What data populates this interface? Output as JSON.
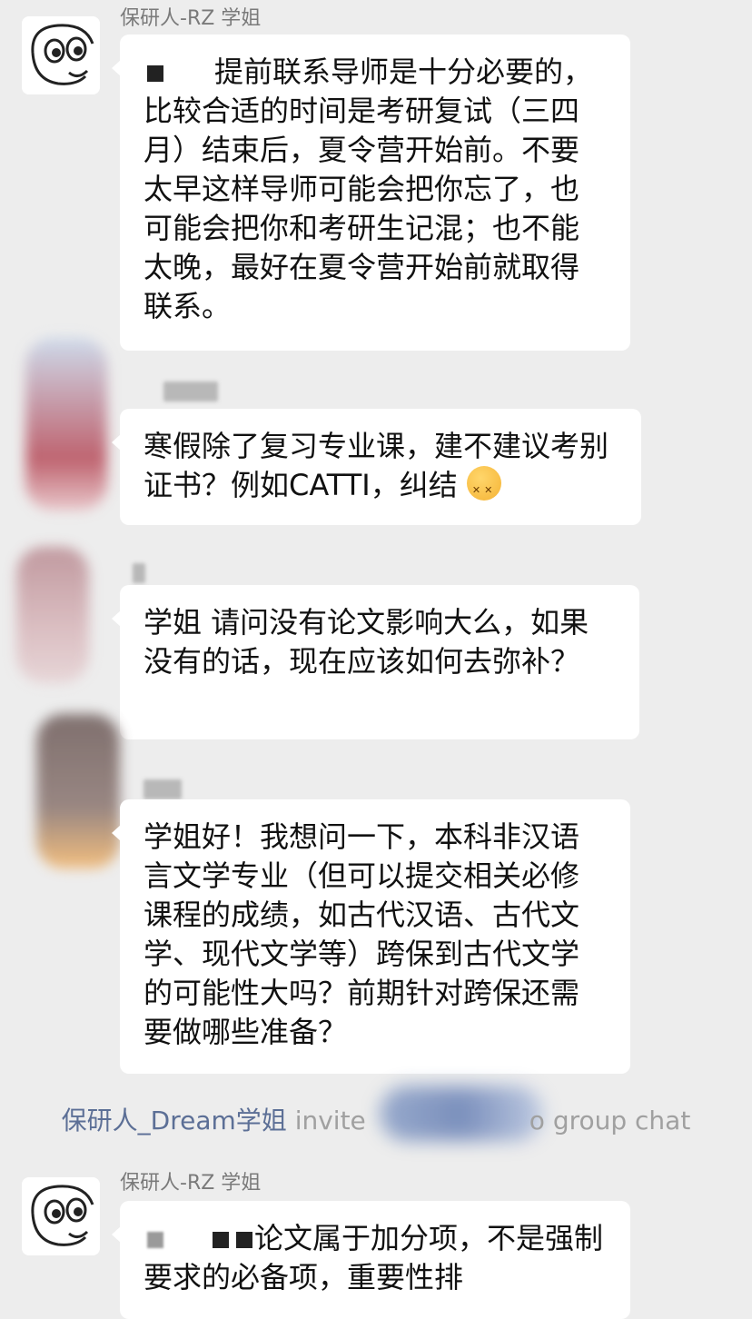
{
  "messages": [
    {
      "sender": "保研人-RZ 学姐",
      "text": "提前联系导师是十分必要的，比较合适的时间是考研复试（三四月）结束后，夏令营开始前。不要太早这样导师可能会把你忘了，也可能会把你和考研生记混；也不能太晚，最好在夏令营开始前就取得联系。"
    },
    {
      "sender": "",
      "text": "寒假除了复习专业课，建不建议考别证书？例如CATTI，纠结",
      "emoji": "persevering-face"
    },
    {
      "sender": "",
      "text": "学姐 请问没有论文影响大么，如果没有的话，现在应该如何去弥补？"
    },
    {
      "sender": "",
      "text": "学姐好！我想问一下，本科非汉语言文学专业（但可以提交相关必修课程的成绩，如古代汉语、古代文学、现代文学等）跨保到古代文学的可能性大吗？前期针对跨保还需要做哪些准备？"
    },
    {
      "sender": "保研人-RZ 学姐",
      "text": "论文属于加分项，不是强制要求的必备项，重要性排"
    }
  ],
  "system_notice": {
    "inviter": "保研人_Dream学姐",
    "text_start": " invite",
    "text_end": "o group chat"
  },
  "colors": {
    "background": "#ededed",
    "bubble": "#ffffff",
    "system_name": "#5c6f96"
  }
}
